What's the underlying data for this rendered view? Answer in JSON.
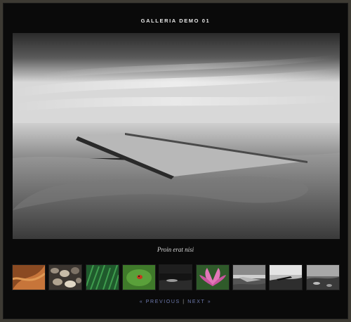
{
  "gallery": {
    "title": "GALLERIA DEMO 01",
    "caption": "Proin erat nisi",
    "nav": {
      "prev_label": "« PREVIOUS",
      "separator": "|",
      "next_label": "NEXT »"
    }
  },
  "thumbnails": [
    {
      "name": "thumb-orange-abstract",
      "active": false
    },
    {
      "name": "thumb-pebbles",
      "active": false
    },
    {
      "name": "thumb-green-grass",
      "active": false
    },
    {
      "name": "thumb-ladybug-leaf",
      "active": false
    },
    {
      "name": "thumb-dark-landscape",
      "active": false
    },
    {
      "name": "thumb-pink-lotus",
      "active": false
    },
    {
      "name": "thumb-bw-pier",
      "active": true
    },
    {
      "name": "thumb-bw-beach",
      "active": false
    },
    {
      "name": "thumb-bw-shore",
      "active": false
    }
  ],
  "colors": {
    "frame": "#3d3a33",
    "background": "#0a0a0a",
    "nav_link": "#6f7bb0"
  }
}
